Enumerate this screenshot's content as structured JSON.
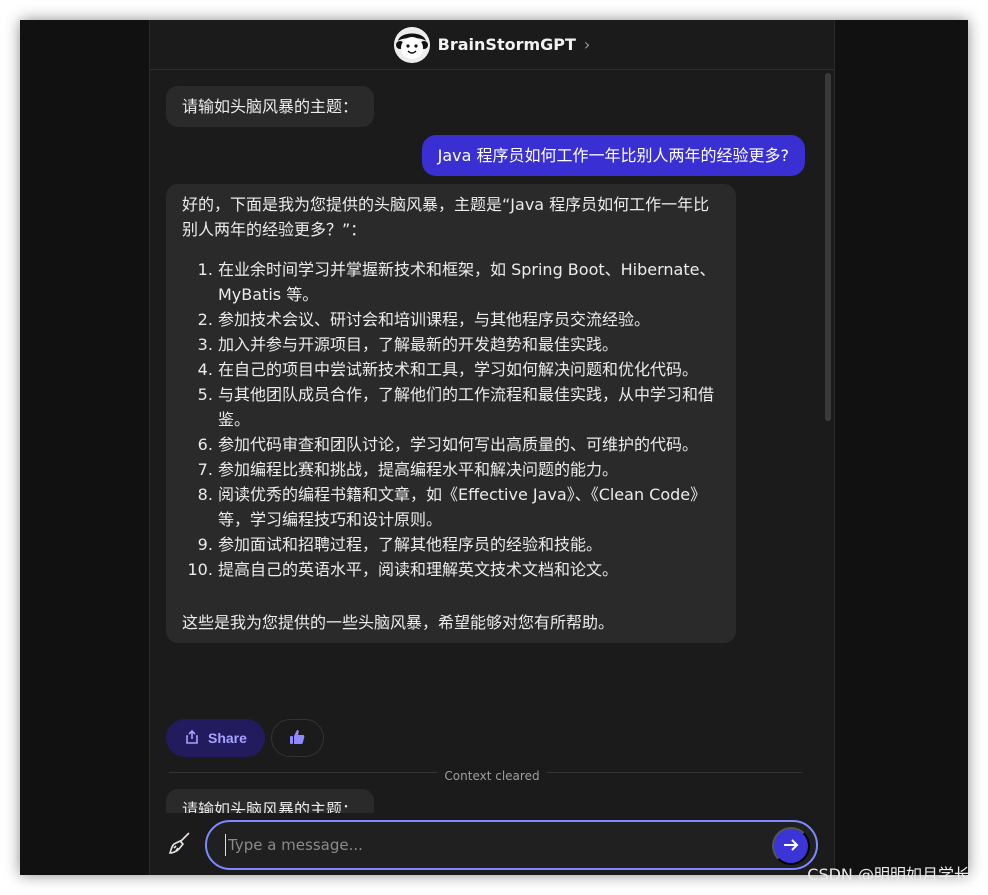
{
  "header": {
    "bot_name": "BrainStormGPT",
    "chevron": "›"
  },
  "messages": {
    "prompt_1": "请输如头脑风暴的主题：",
    "user_1": "Java 程序员如何工作一年比别人两年的经验更多?",
    "bot_intro": "好的，下面是我为您提供的头脑风暴，主题是“Java 程序员如何工作一年比别人两年的经验更多？”：",
    "bot_items": [
      "在业余时间学习并掌握新技术和框架，如 Spring Boot、Hibernate、MyBatis 等。",
      "参加技术会议、研讨会和培训课程，与其他程序员交流经验。",
      "加入并参与开源项目，了解最新的开发趋势和最佳实践。",
      "在自己的项目中尝试新技术和工具，学习如何解决问题和优化代码。",
      "与其他团队成员合作，了解他们的工作流程和最佳实践，从中学习和借鉴。",
      "参加代码审查和团队讨论，学习如何写出高质量的、可维护的代码。",
      "参加编程比赛和挑战，提高编程水平和解决问题的能力。",
      "阅读优秀的编程书籍和文章，如《Effective Java》、《Clean Code》等，学习编程技巧和设计原则。",
      "参加面试和招聘过程，了解其他程序员的经验和技能。",
      "提高自己的英语水平，阅读和理解英文技术文档和论文。"
    ],
    "bot_outro": "这些是我为您提供的一些头脑风暴，希望能够对您有所帮助。",
    "prompt_2": "请输如头脑风暴的主题："
  },
  "actions": {
    "share_label": "Share"
  },
  "divider": {
    "label": "Context cleared"
  },
  "composer": {
    "placeholder": "Type a message..."
  },
  "watermark": "CSDN @明明如月学长",
  "colors": {
    "accent": "#3b35d8",
    "user_bubble": "#3a2fd2",
    "focus_border": "#7f89ff"
  },
  "icons": [
    "avatar-icon",
    "chevron-right-icon",
    "share-icon",
    "thumbs-up-icon",
    "broom-icon",
    "send-arrow-icon"
  ]
}
